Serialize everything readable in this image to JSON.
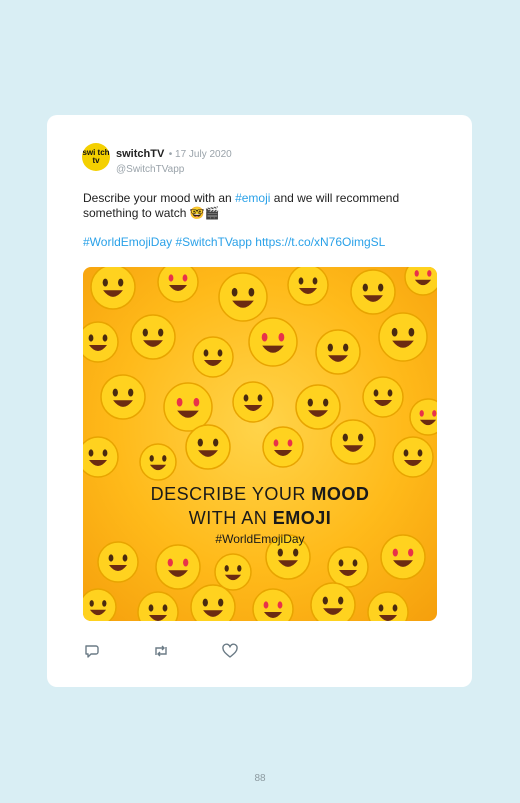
{
  "post": {
    "account_name": "switchTV",
    "date": "• 17 July 2020",
    "handle": "@SwitchTVapp",
    "avatar_text": "swi tch tv",
    "text_before_link": "Describe your mood with an ",
    "hashtag_inline": "#emoji",
    "text_after_link": " and we will recommend something to watch 🤓🎬",
    "tags_line": "#WorldEmojiDay #SwitchTVapp https://t.co/xN76OimgSL"
  },
  "image": {
    "headline_line1_regular": "DESCRIBE YOUR ",
    "headline_line1_bold": "MOOD",
    "headline_line2_regular": "WITH AN ",
    "headline_line2_bold": "EMOJI",
    "hashtag": "#WorldEmojiDay"
  },
  "actions": [
    "reply-icon",
    "retweet-icon",
    "like-icon"
  ],
  "colors": {
    "background": "#d9eef4",
    "card": "#ffffff",
    "link": "#2aa1e8",
    "avatar": "#f4d000"
  },
  "page_number": "88"
}
